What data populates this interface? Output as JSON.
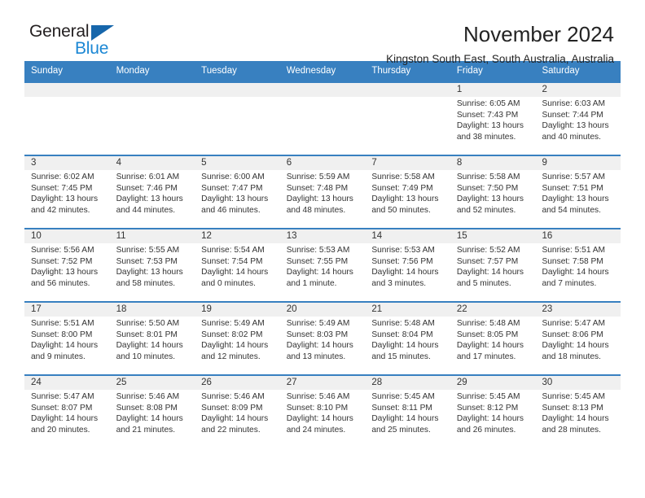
{
  "brand": {
    "name_part1": "General",
    "name_part2": "Blue",
    "triangle_color": "#1666ab",
    "blue_color": "#1b87d4"
  },
  "header": {
    "title": "November 2024",
    "subtitle": "Kingston South East, South Australia, Australia"
  },
  "theme": {
    "header_blue": "#3880c0",
    "daynum_band": "#f0f0f0",
    "text": "#333333"
  },
  "calendar": {
    "weekdays": [
      "Sunday",
      "Monday",
      "Tuesday",
      "Wednesday",
      "Thursday",
      "Friday",
      "Saturday"
    ],
    "weeks": [
      [
        {
          "day": "",
          "sunrise": "",
          "sunset": "",
          "daylight": ""
        },
        {
          "day": "",
          "sunrise": "",
          "sunset": "",
          "daylight": ""
        },
        {
          "day": "",
          "sunrise": "",
          "sunset": "",
          "daylight": ""
        },
        {
          "day": "",
          "sunrise": "",
          "sunset": "",
          "daylight": ""
        },
        {
          "day": "",
          "sunrise": "",
          "sunset": "",
          "daylight": ""
        },
        {
          "day": "1",
          "sunrise": "Sunrise: 6:05 AM",
          "sunset": "Sunset: 7:43 PM",
          "daylight": "Daylight: 13 hours and 38 minutes."
        },
        {
          "day": "2",
          "sunrise": "Sunrise: 6:03 AM",
          "sunset": "Sunset: 7:44 PM",
          "daylight": "Daylight: 13 hours and 40 minutes."
        }
      ],
      [
        {
          "day": "3",
          "sunrise": "Sunrise: 6:02 AM",
          "sunset": "Sunset: 7:45 PM",
          "daylight": "Daylight: 13 hours and 42 minutes."
        },
        {
          "day": "4",
          "sunrise": "Sunrise: 6:01 AM",
          "sunset": "Sunset: 7:46 PM",
          "daylight": "Daylight: 13 hours and 44 minutes."
        },
        {
          "day": "5",
          "sunrise": "Sunrise: 6:00 AM",
          "sunset": "Sunset: 7:47 PM",
          "daylight": "Daylight: 13 hours and 46 minutes."
        },
        {
          "day": "6",
          "sunrise": "Sunrise: 5:59 AM",
          "sunset": "Sunset: 7:48 PM",
          "daylight": "Daylight: 13 hours and 48 minutes."
        },
        {
          "day": "7",
          "sunrise": "Sunrise: 5:58 AM",
          "sunset": "Sunset: 7:49 PM",
          "daylight": "Daylight: 13 hours and 50 minutes."
        },
        {
          "day": "8",
          "sunrise": "Sunrise: 5:58 AM",
          "sunset": "Sunset: 7:50 PM",
          "daylight": "Daylight: 13 hours and 52 minutes."
        },
        {
          "day": "9",
          "sunrise": "Sunrise: 5:57 AM",
          "sunset": "Sunset: 7:51 PM",
          "daylight": "Daylight: 13 hours and 54 minutes."
        }
      ],
      [
        {
          "day": "10",
          "sunrise": "Sunrise: 5:56 AM",
          "sunset": "Sunset: 7:52 PM",
          "daylight": "Daylight: 13 hours and 56 minutes."
        },
        {
          "day": "11",
          "sunrise": "Sunrise: 5:55 AM",
          "sunset": "Sunset: 7:53 PM",
          "daylight": "Daylight: 13 hours and 58 minutes."
        },
        {
          "day": "12",
          "sunrise": "Sunrise: 5:54 AM",
          "sunset": "Sunset: 7:54 PM",
          "daylight": "Daylight: 14 hours and 0 minutes."
        },
        {
          "day": "13",
          "sunrise": "Sunrise: 5:53 AM",
          "sunset": "Sunset: 7:55 PM",
          "daylight": "Daylight: 14 hours and 1 minute."
        },
        {
          "day": "14",
          "sunrise": "Sunrise: 5:53 AM",
          "sunset": "Sunset: 7:56 PM",
          "daylight": "Daylight: 14 hours and 3 minutes."
        },
        {
          "day": "15",
          "sunrise": "Sunrise: 5:52 AM",
          "sunset": "Sunset: 7:57 PM",
          "daylight": "Daylight: 14 hours and 5 minutes."
        },
        {
          "day": "16",
          "sunrise": "Sunrise: 5:51 AM",
          "sunset": "Sunset: 7:58 PM",
          "daylight": "Daylight: 14 hours and 7 minutes."
        }
      ],
      [
        {
          "day": "17",
          "sunrise": "Sunrise: 5:51 AM",
          "sunset": "Sunset: 8:00 PM",
          "daylight": "Daylight: 14 hours and 9 minutes."
        },
        {
          "day": "18",
          "sunrise": "Sunrise: 5:50 AM",
          "sunset": "Sunset: 8:01 PM",
          "daylight": "Daylight: 14 hours and 10 minutes."
        },
        {
          "day": "19",
          "sunrise": "Sunrise: 5:49 AM",
          "sunset": "Sunset: 8:02 PM",
          "daylight": "Daylight: 14 hours and 12 minutes."
        },
        {
          "day": "20",
          "sunrise": "Sunrise: 5:49 AM",
          "sunset": "Sunset: 8:03 PM",
          "daylight": "Daylight: 14 hours and 13 minutes."
        },
        {
          "day": "21",
          "sunrise": "Sunrise: 5:48 AM",
          "sunset": "Sunset: 8:04 PM",
          "daylight": "Daylight: 14 hours and 15 minutes."
        },
        {
          "day": "22",
          "sunrise": "Sunrise: 5:48 AM",
          "sunset": "Sunset: 8:05 PM",
          "daylight": "Daylight: 14 hours and 17 minutes."
        },
        {
          "day": "23",
          "sunrise": "Sunrise: 5:47 AM",
          "sunset": "Sunset: 8:06 PM",
          "daylight": "Daylight: 14 hours and 18 minutes."
        }
      ],
      [
        {
          "day": "24",
          "sunrise": "Sunrise: 5:47 AM",
          "sunset": "Sunset: 8:07 PM",
          "daylight": "Daylight: 14 hours and 20 minutes."
        },
        {
          "day": "25",
          "sunrise": "Sunrise: 5:46 AM",
          "sunset": "Sunset: 8:08 PM",
          "daylight": "Daylight: 14 hours and 21 minutes."
        },
        {
          "day": "26",
          "sunrise": "Sunrise: 5:46 AM",
          "sunset": "Sunset: 8:09 PM",
          "daylight": "Daylight: 14 hours and 22 minutes."
        },
        {
          "day": "27",
          "sunrise": "Sunrise: 5:46 AM",
          "sunset": "Sunset: 8:10 PM",
          "daylight": "Daylight: 14 hours and 24 minutes."
        },
        {
          "day": "28",
          "sunrise": "Sunrise: 5:45 AM",
          "sunset": "Sunset: 8:11 PM",
          "daylight": "Daylight: 14 hours and 25 minutes."
        },
        {
          "day": "29",
          "sunrise": "Sunrise: 5:45 AM",
          "sunset": "Sunset: 8:12 PM",
          "daylight": "Daylight: 14 hours and 26 minutes."
        },
        {
          "day": "30",
          "sunrise": "Sunrise: 5:45 AM",
          "sunset": "Sunset: 8:13 PM",
          "daylight": "Daylight: 14 hours and 28 minutes."
        }
      ]
    ]
  }
}
